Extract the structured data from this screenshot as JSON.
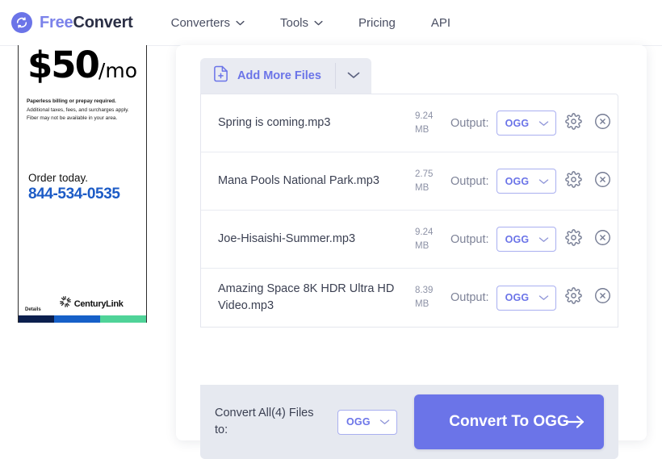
{
  "brand": {
    "icon": "refresh-circle-logo",
    "name_first": "Free",
    "name_second": "Convert"
  },
  "nav": {
    "items": [
      {
        "label": "Converters",
        "has_caret": true,
        "icon": "chevron-down-icon"
      },
      {
        "label": "Tools",
        "has_caret": true,
        "icon": "chevron-down-icon"
      },
      {
        "label": "Pricing",
        "has_caret": false
      },
      {
        "label": "API",
        "has_caret": false
      }
    ]
  },
  "ad": {
    "price_amount": "$50",
    "price_period": "/mo",
    "fine_print_bold": "Paperless billing or prepay required.",
    "fine_print_line2": "Additional taxes, fees, and surcharges apply.",
    "fine_print_line3": "Fiber may not be available in your area.",
    "order_text": "Order today.",
    "phone": "844-534-0535",
    "details_label": "Details",
    "advertiser": "CenturyLink",
    "advertiser_mark": "starburst-icon",
    "bar_colors": [
      "#0b1f4e",
      "#1660c8",
      "#4fd398"
    ]
  },
  "toolbar": {
    "add_more_label": "Add More Files",
    "add_more_icon": "file-plus-icon",
    "dropdown_icon": "chevron-down-icon"
  },
  "files": {
    "output_label": "Output:",
    "settings_icon": "gear-icon",
    "remove_icon": "close-circle-icon",
    "select_caret_icon": "chevron-down-icon",
    "rows": [
      {
        "name": "Spring is coming.mp3",
        "size_value": "9.24",
        "size_unit": "MB",
        "output_format": "OGG"
      },
      {
        "name": "Mana Pools National Park.mp3",
        "size_value": "2.75",
        "size_unit": "MB",
        "output_format": "OGG"
      },
      {
        "name": "Joe-Hisaishi-Summer.mp3",
        "size_value": "9.24",
        "size_unit": "MB",
        "output_format": "OGG"
      },
      {
        "name": "Amazing Space 8K HDR Ultra HD Video.mp3",
        "size_value": "8.39",
        "size_unit": "MB",
        "output_format": "OGG"
      }
    ]
  },
  "convert_bar": {
    "label": "Convert All(4) Files to:",
    "format": "OGG",
    "button_label": "Convert To OGG",
    "button_arrow_icon": "arrow-right-icon",
    "accent_color": "#6b74e8"
  }
}
